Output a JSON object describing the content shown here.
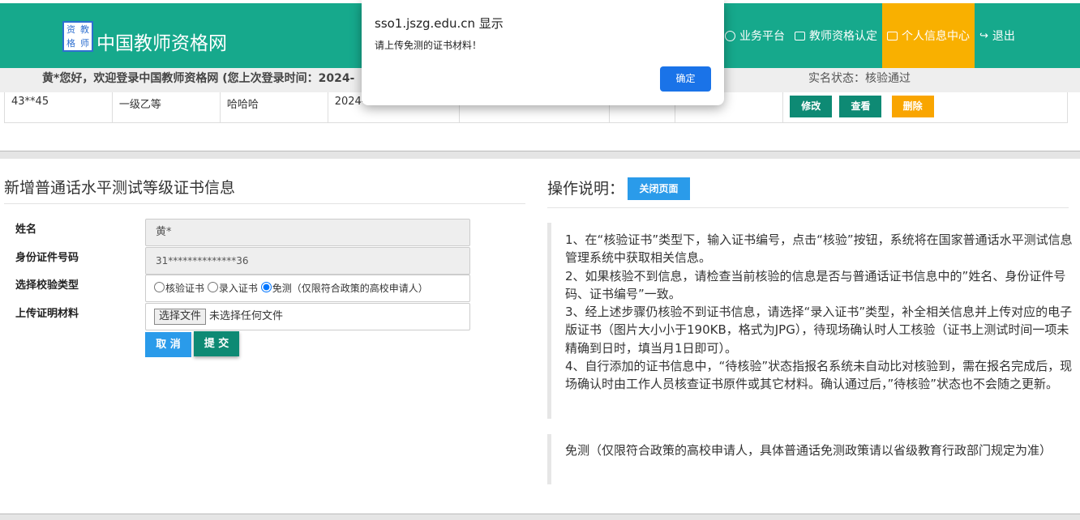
{
  "header": {
    "logo_chars": [
      "资",
      "教",
      "格",
      "师"
    ],
    "site_title": "中国教师资格网",
    "nav": [
      {
        "label": "业务平台",
        "icon": "dashboard-icon"
      },
      {
        "label": "教师资格认定",
        "icon": "monitor-icon"
      },
      {
        "label": "个人信息中心",
        "icon": "monitor-icon",
        "active": true
      },
      {
        "label": "退出",
        "icon": "logout-icon"
      }
    ],
    "colors": {
      "bar": "#16a98c",
      "active": "#f9b000"
    }
  },
  "welcome": {
    "text": "黄*您好，欢迎登录中国教师资格网 (您上次登录时间：2024-",
    "realname_status": "实名状态：核验通过"
  },
  "table_row": {
    "cert_no": "43**45",
    "level": "一级乙等",
    "name": "哈哈哈",
    "date": "2024-",
    "actions": {
      "edit": "修改",
      "view": "查看",
      "delete": "删除"
    }
  },
  "form": {
    "title": "新增普通话水平测试等级证书信息",
    "name_label": "姓名",
    "name_value": "黄*",
    "id_label": "身份证件号码",
    "id_value": "31**************36",
    "type_label": "选择校验类型",
    "radio_options": [
      "核验证书",
      "录入证书",
      "免测（仅限符合政策的高校申请人）"
    ],
    "radio_selected": 2,
    "upload_label": "上传证明材料",
    "file_button": "选择文件",
    "file_status": "未选择任何文件",
    "cancel": "取 消",
    "submit": "提 交"
  },
  "ops": {
    "title": "操作说明：",
    "close_button": "关闭页面",
    "note1": "1、在“核验证书”类型下，输入证书编号，点击“核验”按钮，系统将在国家普通话水平测试信息管理系统中获取相关信息。\n2、如果核验不到信息，请检查当前核验的信息是否与普通话证书信息中的”姓名、身份证件号码、证书编号”一致。\n3、经上述步骤仍核验不到证书信息，请选择“录入证书”类型，补全相关信息并上传对应的电子版证书（图片大小小于190KB，格式为JPG），待现场确认时人工核验（证书上测试时间一项未精确到日时，填当月1日即可）。\n4、自行添加的证书信息中，“待核验”状态指报名系统未自动比对核验到，需在报名完成后，现场确认时由工作人员核查证书原件或其它材料。确认通过后，”待核验”状态也不会随之更新。",
    "note2": "免测（仅限符合政策的高校申请人，具体普通话免测政策请以省级教育行政部门规定为准）"
  },
  "dialog": {
    "title": "sso1.jszg.edu.cn 显示",
    "message": "请上传免测的证书材料！",
    "ok": "确定"
  }
}
